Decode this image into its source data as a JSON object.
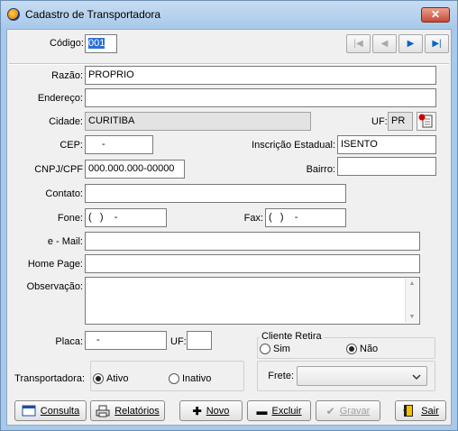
{
  "window": {
    "title": "Cadastro de Transportadora",
    "close_label": "✕"
  },
  "nav": {
    "first": "|◀",
    "prev": "◀",
    "next": "▶",
    "last": "▶|"
  },
  "codigo": {
    "label": "Código:",
    "value": "001"
  },
  "razao": {
    "label": "Razão:",
    "value": "PROPRIO"
  },
  "endereco": {
    "label": "Endereço:",
    "value": ""
  },
  "cidade": {
    "label": "Cidade:",
    "value": "CURITIBA"
  },
  "uf": {
    "label": "UF:",
    "value": "PR"
  },
  "cep": {
    "label": "CEP:",
    "value": "-"
  },
  "inscricao": {
    "label": "Inscrição Estadual:",
    "value": "ISENTO"
  },
  "cnpj": {
    "label": "CNPJ/CPF",
    "value": "000.000.000-00000"
  },
  "bairro": {
    "label": "Bairro:",
    "value": ""
  },
  "contato": {
    "label": "Contato:",
    "value": ""
  },
  "fone": {
    "label": "Fone:",
    "value": "(   )    -"
  },
  "fax": {
    "label": "Fax:",
    "value": "(   )    -"
  },
  "email": {
    "label": "e - Mail:",
    "value": ""
  },
  "homepage": {
    "label": "Home Page:",
    "value": ""
  },
  "observacao": {
    "label": "Observação:",
    "value": ""
  },
  "placa": {
    "label": "Placa:",
    "value": "-"
  },
  "placa_uf": {
    "label": "UF:",
    "value": ""
  },
  "cliente_retira": {
    "label": "Cliente Retira",
    "options": [
      "Sim",
      "Não"
    ],
    "selected": "Não"
  },
  "transportadora": {
    "label": "Transportadora:",
    "options": [
      "Ativo",
      "Inativo"
    ],
    "selected": "Ativo"
  },
  "frete": {
    "label": "Frete:",
    "value": ""
  },
  "buttons": {
    "consulta": "Consulta",
    "relatorios": "Relatórios",
    "novo": "Novo",
    "excluir": "Excluir",
    "gravar": "Gravar",
    "sair": "Sair"
  },
  "colors": {
    "titlebar": "#a9c9ea",
    "close": "#c74a34",
    "selection": "#2b6fd6"
  }
}
